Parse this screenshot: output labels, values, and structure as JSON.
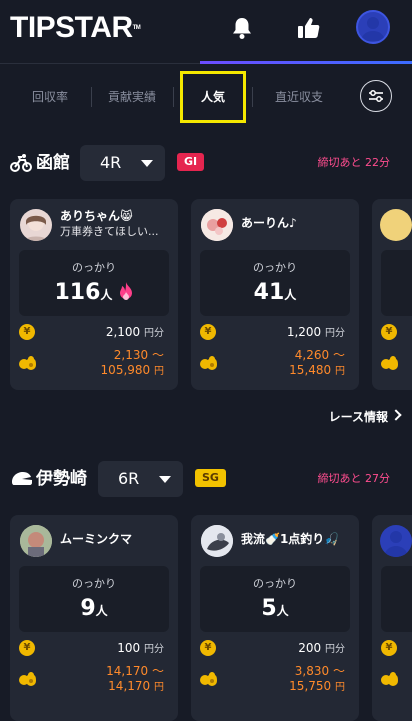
{
  "app": {
    "logo": "TIPSTAR"
  },
  "header": {
    "icons": [
      "bell-icon",
      "thumbs-up-icon",
      "user-avatar"
    ]
  },
  "tabs": [
    {
      "label": "回収率",
      "active": false
    },
    {
      "label": "貢献実績",
      "active": false
    },
    {
      "label": "人気",
      "active": true
    },
    {
      "label": "直近収支",
      "active": false
    }
  ],
  "races": [
    {
      "venue": "函館",
      "race_no": "4R",
      "grade": "GI",
      "deadline": "締切あと 22分",
      "cards": [
        {
          "name": "ありちゃん😸",
          "sub": "万車券きてほしい...",
          "label": "のっかり",
          "count": "116",
          "unit": "人",
          "hot": true,
          "bet": "2,100",
          "bet_unit": "円分",
          "payout_low": "2,130",
          "payout_high": "105,980",
          "payout_unit": "円",
          "tilde": "〜"
        },
        {
          "name": "あーりん♪",
          "sub": "",
          "label": "のっかり",
          "count": "41",
          "unit": "人",
          "hot": false,
          "bet": "1,200",
          "bet_unit": "円分",
          "payout_low": "4,260",
          "payout_high": "15,480",
          "payout_unit": "円",
          "tilde": "〜"
        }
      ],
      "race_info_link": "レース情報"
    },
    {
      "venue": "伊勢崎",
      "race_no": "6R",
      "grade": "SG",
      "deadline": "締切あと 27分",
      "cards": [
        {
          "name": "ムーミンクマ",
          "sub": "",
          "label": "のっかり",
          "count": "9",
          "unit": "人",
          "hot": false,
          "bet": "100",
          "bet_unit": "円分",
          "payout_low": "14,170",
          "payout_high": "14,170",
          "payout_unit": "円",
          "tilde": "〜"
        },
        {
          "name": "我流🍼1点釣り🎣",
          "sub": "",
          "label": "のっかり",
          "count": "5",
          "unit": "人",
          "hot": false,
          "bet": "200",
          "bet_unit": "円分",
          "payout_low": "3,830",
          "payout_high": "15,750",
          "payout_unit": "円",
          "tilde": "〜"
        }
      ]
    }
  ],
  "colors": {
    "background": "#171b26",
    "card": "#232834",
    "accent_pink": "#ff4d8f",
    "payout_orange": "#ff8a2b",
    "gi_red": "#e5254f",
    "sg_yellow": "#f2c200",
    "highlight": "#f5e800"
  }
}
